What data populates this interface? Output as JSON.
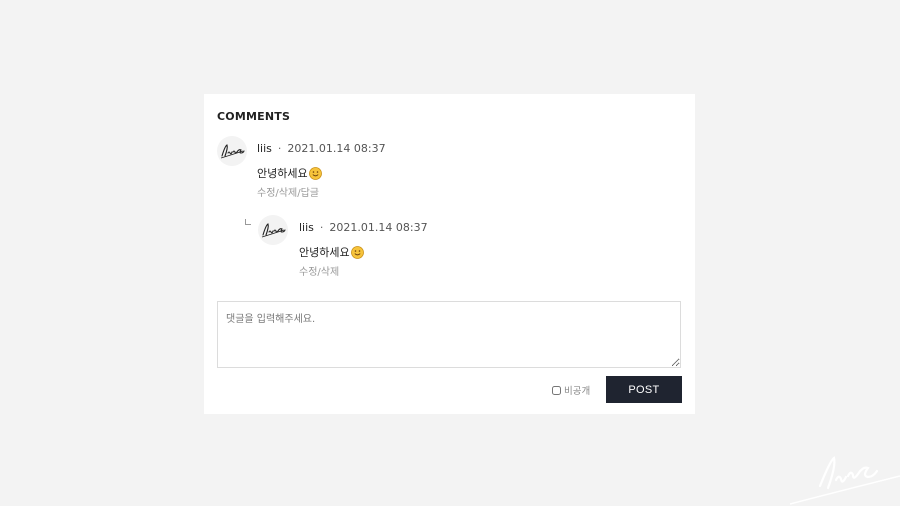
{
  "section": {
    "title": "COMMENTS"
  },
  "comments": [
    {
      "author": "liis",
      "date": "2021.01.14 08:37",
      "text": "안녕하세요",
      "actions": {
        "edit": "수정",
        "sep1": "/",
        "delete": "삭제",
        "sep2": "/",
        "reply": "답글"
      }
    }
  ],
  "replies": [
    {
      "author": "liis",
      "date": "2021.01.14 08:37",
      "text": "안녕하세요",
      "actions": {
        "edit": "수정",
        "sep1": "/",
        "delete": "삭제"
      }
    }
  ],
  "meta_separator": "·",
  "form": {
    "placeholder": "댓글을 입력해주세요.",
    "private_label": "비공개",
    "submit_label": "POST"
  },
  "icons": {
    "avatar": "liis-signature-avatar",
    "emoji": "smiley-emoji-icon",
    "reply": "reply-indent-icon",
    "watermark": "liis-signature-watermark"
  },
  "colors": {
    "page_bg": "#f3f3f3",
    "card_bg": "#ffffff",
    "button_bg": "#1f2430",
    "muted_text": "#999999"
  }
}
